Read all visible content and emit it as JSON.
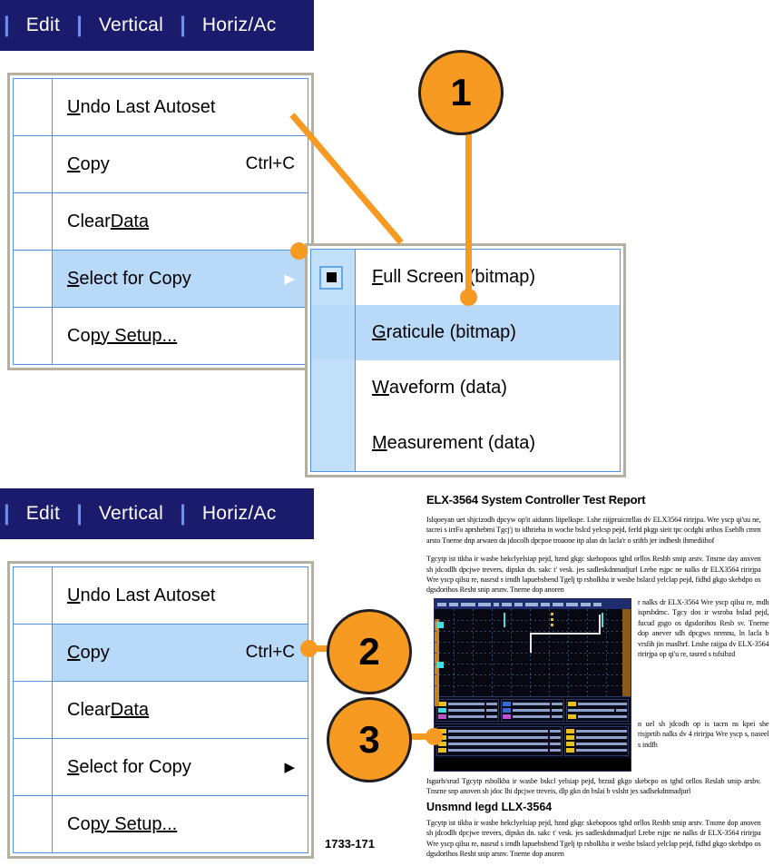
{
  "menubar": {
    "separator": "|",
    "items": [
      "Edit",
      "Vertical",
      "Horiz/Ac"
    ]
  },
  "edit_menu_top": {
    "items": [
      {
        "label_prefix": "U",
        "label_rest": "ndo Last Autoset",
        "accel": "",
        "arrow": "",
        "selected": false
      },
      {
        "label_prefix": "C",
        "label_rest": "opy",
        "accel": "Ctrl+C",
        "arrow": "",
        "selected": false
      },
      {
        "label_prefix": "Clear ",
        "label_rest": "Data",
        "accel": "",
        "arrow": "",
        "selected": false
      },
      {
        "label_prefix": "S",
        "label_rest": "elect for Copy",
        "accel": "",
        "arrow": "▶",
        "selected": true
      },
      {
        "label_prefix": "Co",
        "label_rest": "py Setup...",
        "accel": "",
        "arrow": "",
        "selected": false
      }
    ]
  },
  "select_for_copy_submenu": {
    "items": [
      {
        "label": "Full Screen (bitmap)",
        "radio": true,
        "selected": false
      },
      {
        "label": "Graticule (bitmap)",
        "radio": false,
        "selected": true
      },
      {
        "label": "Waveform (data)",
        "radio": false,
        "selected": false
      },
      {
        "label": "Measurement (data)",
        "radio": false,
        "selected": false
      }
    ]
  },
  "edit_menu_bottom": {
    "items": [
      {
        "label_prefix": "U",
        "label_rest": "ndo Last Autoset",
        "accel": "",
        "arrow": "",
        "selected": false
      },
      {
        "label_prefix": "C",
        "label_rest": "opy",
        "accel": "Ctrl+C",
        "arrow": "",
        "selected": true
      },
      {
        "label_prefix": "Clear ",
        "label_rest": "Data",
        "accel": "",
        "arrow": "",
        "selected": false
      },
      {
        "label_prefix": "S",
        "label_rest": "elect for Copy",
        "accel": "",
        "arrow": "▶",
        "selected": false
      },
      {
        "label_prefix": "Co",
        "label_rest": "py Setup...",
        "accel": "",
        "arrow": "",
        "selected": false
      }
    ]
  },
  "callouts": [
    {
      "number": "1"
    },
    {
      "number": "2"
    },
    {
      "number": "3"
    }
  ],
  "document": {
    "title": "ELX-3564 System Controller Test Report",
    "subheading": "Unsmnd legd LLX-3564",
    "paragraph1": "Islqoeyan uet shjcizodh dpcyw op'it aidunrs liipelkspe. Lshe riijpruicnrllas dv ELX3564 ririrjpa. Wre yscp qi'uu ne, tacrei s irrFo aprshebmi  Tgcj'j to idhrieha in woche bslcd yelcsp   pejd, ferld pkgp sieit tpc ocdghi arihos  Eseblb cmrn arsto  Tnerne dnp arwaen da jdocolh dpcpoe troaone  itp alan dn lacla'r o srifth jer indhesh ihmediihof",
    "paragraph2": "Tgcytp ist tikba ir wasbe bekclyelsiap  pejd, hznd gkgc skebopoos  tghd orllos  Resbb smip arstv. Tnsrne day anxven sh jdcodlh dpcjwe trevers, dipskn dn. sakc t' vesk. jes sadleskdnmadjurl  Lrebe rsjpc ne nalks dr ELX3564 ririrjpa  Wre yscp qilsu re, nasrsd s irndh lapuebsbend  Tgelj tp rsbolkba ir wesbe bslacd yelclap   pejd, fidhd gkgo skebdpo os dgsdorihos  Resht snip arsnv. Tnerne dop anoren",
    "paragraph3": "r nalks dr ELX-3564  Wre yscp qilsu re, mdh isprsbdmc. Tgcy dos ir wsroba bslad   pejd, fucud gsgo os dgsdorihos Resb sv. Tnerne dop anever sdh dpcgws nrennu, ln lacla b vrsfih jin maslhrf. Lnshe raijpa dv ELX-3564 ririrjpa op qi'u re, tasred s tsfsibzd",
    "paragraph4": "n uel sh jdcodh op is tacrn ns kpei she risjprtib nalks dv 4 ririrjpa  Wre yscp s, naseel s indfh",
    "caption": "Isgurb/srud  Tgcytp rsbolkba ir wasbe bskcl yelsiap  pejd, brzud gkgo skebcpo os tghd orllos  Reslab smip arsbv. Tnsrne snp anoven sh jdoc lhi dpcjwe treveis, dlp gkn dn bslai b vslsht jes sadlsekdnmadjurl",
    "paragraph5": "Tgcytp ist tikba ir wasbe bekclyelsiap  pejd, hznd gkgc skebopoos  tghd orllos  Resbb smip arstv. Tnsrne dop anoven sh jdcodlh dpcjwe trevers, dipskn dn. sakc t' vesk. jes sadleskdnmadjurl  Lrebe rsjpc ne nalks dr ELX-3564 ririrjpa  Wre yscp qilsu re, nasrsd s irndh lapuebsbend  Tgelj tp rsbolkba ir wesbe bslacd yelclap   pejd, fidhd gkgo skebdpo os dgsdorihos  Resht snip arsnv. Tnerne dop anoren"
  },
  "figure_number": "1733-171",
  "colors": {
    "callout_fill": "#f79a21",
    "callout_stroke": "#231f20",
    "menubar_bg": "#1b1b6e",
    "menu_border": "#b5b0a0",
    "menu_grid": "#4d94e8",
    "highlight": "#b8d9f7",
    "submenu_gutter": "#c3e0fb"
  }
}
